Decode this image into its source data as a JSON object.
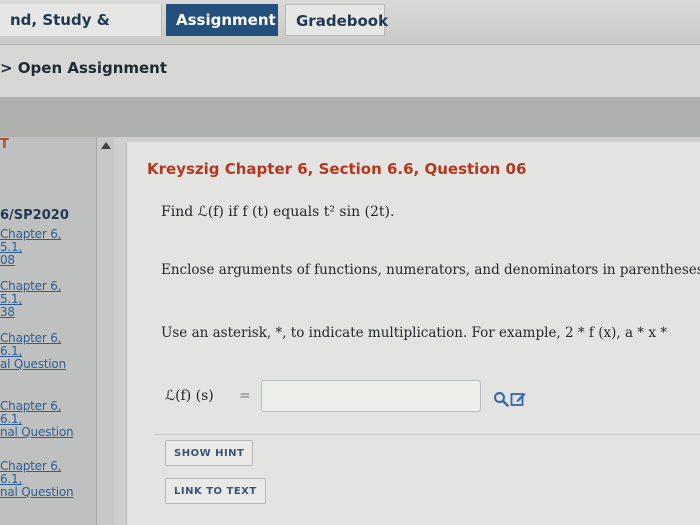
{
  "tabs": {
    "course": "nd, Study & Practice",
    "assignment": "Assignment",
    "gradebook": "Gradebook"
  },
  "breadcrumb": "> Open Assignment",
  "sidebar": {
    "header_letter": "T",
    "course": "6/SP2020",
    "links": [
      "Chapter 6,",
      "5.1,",
      "08",
      "Chapter 6,",
      "5.1,",
      "38",
      "Chapter 6,",
      "6.1,",
      "al Question",
      "Chapter 6,",
      "6.1,",
      "nal Question",
      "Chapter 6,",
      "6.1,",
      "nal Question"
    ]
  },
  "question": {
    "title": "Kreyszig Chapter 6, Section 6.6, Question 06",
    "prompt": "Find ℒ(f) if f (t) equals t² sin (2t).",
    "note1": "Enclose arguments of functions, numerators, and denominators in parentheses. F",
    "note2": "Use an asterisk, *, to indicate multiplication. For example, 2 * f (x), a * x *"
  },
  "answer": {
    "label": "ℒ(f) (s)",
    "equals": "=",
    "value": ""
  },
  "icons": {
    "magnifier": "magnifier-icon",
    "edit": "edit-icon"
  },
  "buttons": {
    "show_hint": "SHOW HINT",
    "link_to_text": "LINK TO TEXT"
  },
  "colors": {
    "tab_active": "#24507d",
    "title_red": "#b4371d",
    "link_blue": "#2d5f95",
    "icon_blue": "#2f68b0"
  }
}
